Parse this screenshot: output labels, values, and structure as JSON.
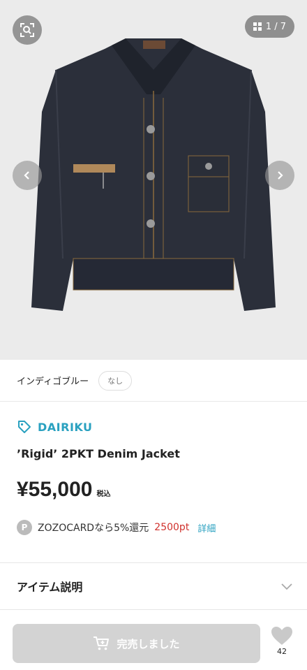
{
  "gallery": {
    "counter": "1 / 7",
    "icons": {
      "lens": "image-search-icon",
      "grid": "grid-icon",
      "prev": "chevron-left-icon",
      "next": "chevron-right-icon"
    }
  },
  "variant": {
    "color_name": "インディゴブルー",
    "stock_label": "なし"
  },
  "product": {
    "brand": "DAIRIKU",
    "name": "’Rigid’ 2PKT Denim Jacket",
    "price": "¥55,000",
    "tax_label": "税込"
  },
  "points": {
    "badge": "P",
    "text": "ZOZOCARDなら5%還元",
    "value": "2500pt",
    "link": "詳細"
  },
  "description": {
    "title": "アイテム説明"
  },
  "actions": {
    "soldout_label": "完売しました",
    "favorite_count": "42"
  },
  "colors": {
    "accent": "#2aa1c0",
    "points_red": "#d0312d",
    "disabled_button": "#d3d3d3"
  }
}
